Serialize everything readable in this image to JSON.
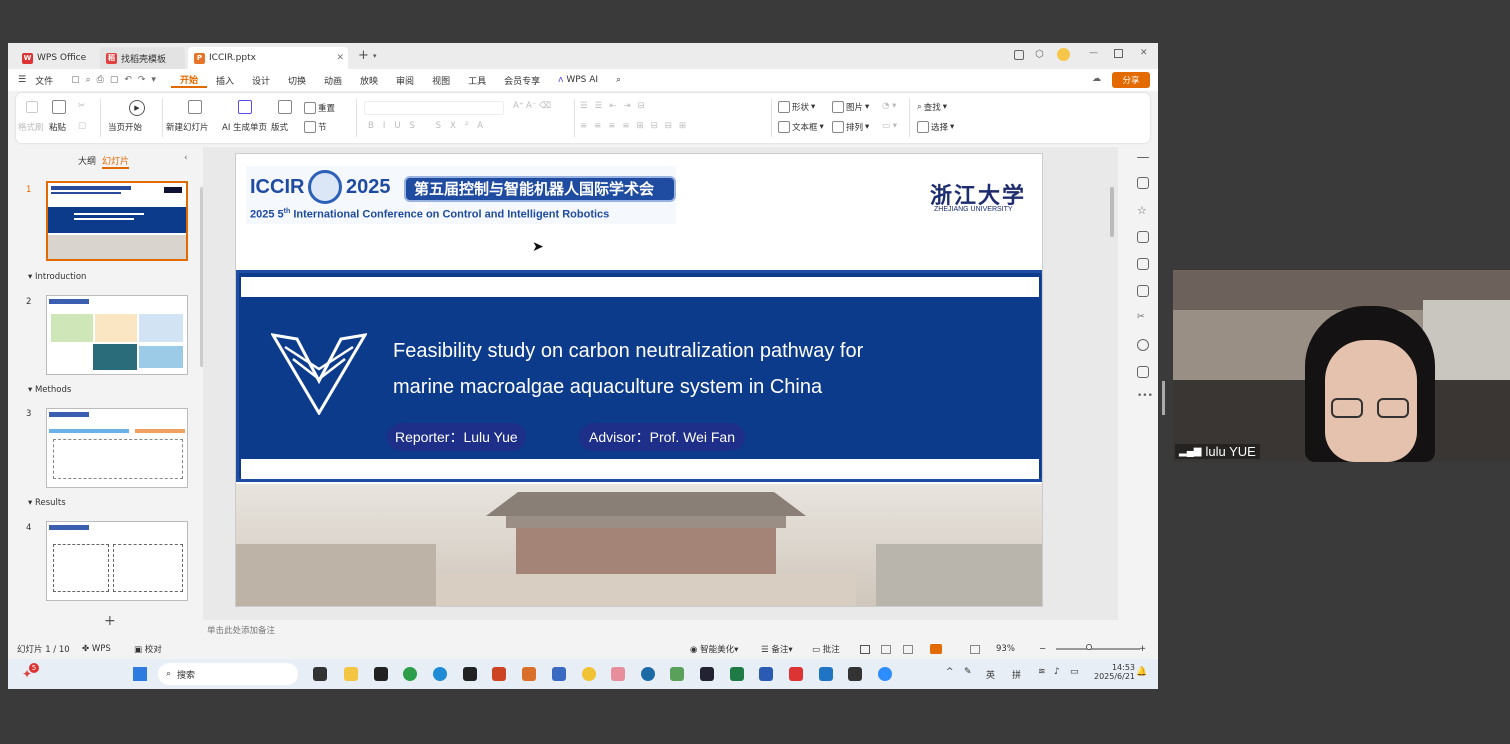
{
  "tabs": [
    {
      "label": "WPS Office"
    },
    {
      "label": "找稻壳模板"
    },
    {
      "label": "ICCIR.pptx"
    }
  ],
  "menu": {
    "file": "文件",
    "items": [
      "开始",
      "插入",
      "设计",
      "切换",
      "动画",
      "放映",
      "审阅",
      "视图",
      "工具",
      "会员专享"
    ],
    "wps_ai": "WPS AI",
    "share": "分享"
  },
  "ribbon": {
    "format_painter": "格式刷",
    "paste": "粘贴",
    "start_current": "当页开始",
    "new_slide": "新建幻灯片",
    "ai_generate": "AI 生成单页",
    "layout": "版式",
    "reset": "重置",
    "section": "节",
    "shape": "形状",
    "picture": "图片",
    "textbox": "文本框",
    "arrange": "排列",
    "find": "查找",
    "select": "选择"
  },
  "panel": {
    "outline": "大纲",
    "slides_tab": "幻灯片",
    "sections": [
      "Introduction",
      "Methods",
      "Results"
    ],
    "nums": [
      "1",
      "2",
      "3",
      "4"
    ]
  },
  "slide": {
    "iccir": "ICCIR",
    "year": "2025",
    "conf_cn": "第五届控制与智能机器人国际学术会议",
    "conf_en_pre": "2025 5",
    "conf_en_sup": "th",
    "conf_en_post": " International Conference on Control and Intelligent Robotics",
    "univ_cn": "浙江大学",
    "univ_en": "ZHEJIANG UNIVERSITY",
    "title_line1": "Feasibility study on carbon neutralization pathway for",
    "title_line2": "marine macroalgae aquaculture system in China",
    "reporter": "Reporter：Lulu Yue",
    "advisor": "Advisor：Prof. Wei Fan"
  },
  "notes_placeholder": "单击此处添加备注",
  "status": {
    "slide_count": "幻灯片 1 / 10",
    "wps": "WPS",
    "proof": "校对",
    "beautify": "智能美化",
    "notes": "备注",
    "comments": "批注",
    "zoom": "93%"
  },
  "taskbar": {
    "search": "搜索",
    "lang": "英",
    "ime": "拼",
    "time": "14:53",
    "date": "2025/6/21",
    "badge": "5"
  },
  "camera": {
    "name": "lulu YUE"
  },
  "colors": {
    "accent": "#e36a00",
    "slide_blue": "#003a8c"
  }
}
